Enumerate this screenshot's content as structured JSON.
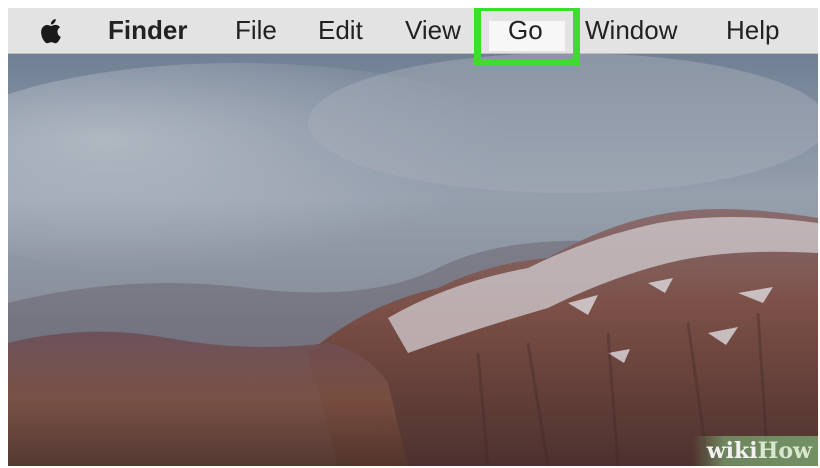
{
  "menubar": {
    "apple_icon": "apple-logo-icon",
    "app_name": "Finder",
    "items": [
      {
        "label": "File"
      },
      {
        "label": "Edit"
      },
      {
        "label": "View"
      },
      {
        "label": "Go",
        "highlighted": true
      },
      {
        "label": "Window"
      },
      {
        "label": "Help"
      }
    ],
    "highlight_color": "#3ddc2f"
  },
  "desktop": {
    "wallpaper": "foggy snow-dusted mountain"
  },
  "watermark": {
    "part1": "wiki",
    "part2": "How"
  }
}
